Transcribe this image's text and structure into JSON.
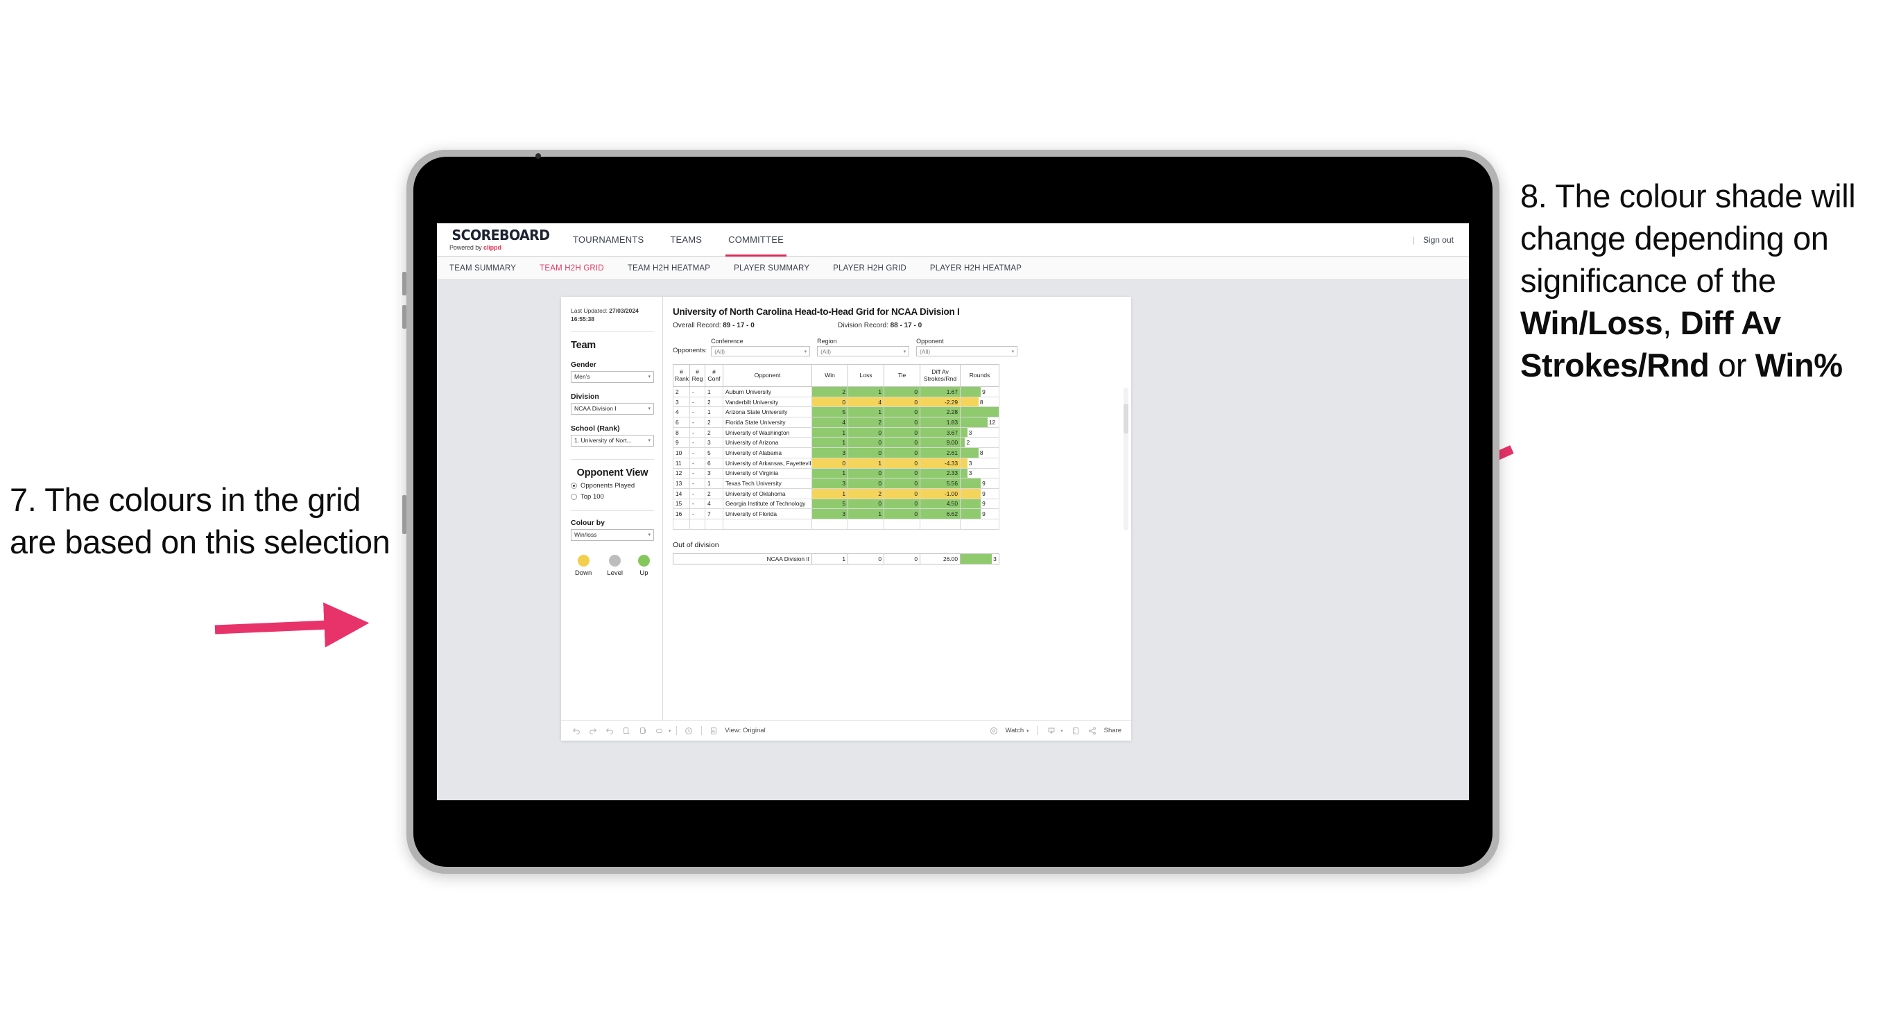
{
  "annotations": {
    "left": {
      "number": "7.",
      "text": "7. The colours in the grid are based on this selection"
    },
    "right": {
      "parts": [
        {
          "text": "8. The colour shade will change depending on significance of the ",
          "bold": false
        },
        {
          "text": "Win/Loss",
          "bold": true
        },
        {
          "text": ", ",
          "bold": false
        },
        {
          "text": "Diff Av Strokes/Rnd",
          "bold": true
        },
        {
          "text": " or ",
          "bold": false
        },
        {
          "text": "Win%",
          "bold": true
        }
      ]
    },
    "arrow_color": "#e8336a"
  },
  "header": {
    "logo_main": "SCOREBOARD",
    "logo_sub_prefix": "Powered by ",
    "logo_sub_brand": "clippd",
    "nav": [
      {
        "label": "TOURNAMENTS",
        "active": false
      },
      {
        "label": "TEAMS",
        "active": false
      },
      {
        "label": "COMMITTEE",
        "active": true
      }
    ],
    "divider": "|",
    "signout": "Sign out"
  },
  "subnav": [
    {
      "label": "TEAM SUMMARY",
      "active": false
    },
    {
      "label": "TEAM H2H GRID",
      "active": true
    },
    {
      "label": "TEAM H2H HEATMAP",
      "active": false
    },
    {
      "label": "PLAYER SUMMARY",
      "active": false
    },
    {
      "label": "PLAYER H2H GRID",
      "active": false
    },
    {
      "label": "PLAYER H2H HEATMAP",
      "active": false
    }
  ],
  "sidebar": {
    "last_updated_label": "Last Updated: ",
    "last_updated_value": "27/03/2024 16:55:38",
    "team_heading": "Team",
    "gender_label": "Gender",
    "gender_value": "Men's",
    "division_label": "Division",
    "division_value": "NCAA Division I",
    "school_label": "School (Rank)",
    "school_value": "1. University of Nort...",
    "opponent_view_heading": "Opponent View",
    "radios": [
      {
        "label": "Opponents Played",
        "selected": true
      },
      {
        "label": "Top 100",
        "selected": false
      }
    ],
    "colour_by_label": "Colour by",
    "colour_by_value": "Win/loss",
    "legend": [
      {
        "label": "Down",
        "color": "#f2cf4d"
      },
      {
        "label": "Level",
        "color": "#bdbdc0"
      },
      {
        "label": "Up",
        "color": "#86c75d"
      }
    ]
  },
  "viz": {
    "title": "University of North Carolina Head-to-Head Grid for NCAA Division I",
    "overall_record_label": "Overall Record: ",
    "overall_record_value": "89 - 17 - 0",
    "division_record_label": "Division Record: ",
    "division_record_value": "88 - 17 - 0",
    "opponents_label": "Opponents:",
    "filters": [
      {
        "label": "Conference",
        "value": "(All)"
      },
      {
        "label": "Region",
        "value": "(All)"
      },
      {
        "label": "Opponent",
        "value": "(All)"
      }
    ],
    "columns": [
      "# Rank",
      "# Reg",
      "# Conf",
      "Opponent",
      "Win",
      "Loss",
      "Tie",
      "Diff Av Strokes/Rnd",
      "Rounds"
    ],
    "rounds_max": 17,
    "rows": [
      {
        "rank": "2",
        "reg": "-",
        "conf": "1",
        "opponent": "Auburn University",
        "win": "2",
        "loss": "1",
        "tie": "0",
        "diff": "1.67",
        "rounds": "9",
        "color": "green"
      },
      {
        "rank": "3",
        "reg": "-",
        "conf": "2",
        "opponent": "Vanderbilt University",
        "win": "0",
        "loss": "4",
        "tie": "0",
        "diff": "-2.29",
        "rounds": "8",
        "color": "yellow"
      },
      {
        "rank": "4",
        "reg": "-",
        "conf": "1",
        "opponent": "Arizona State University",
        "win": "5",
        "loss": "1",
        "tie": "0",
        "diff": "2.28",
        "rounds": "17",
        "color": "green"
      },
      {
        "rank": "6",
        "reg": "-",
        "conf": "2",
        "opponent": "Florida State University",
        "win": "4",
        "loss": "2",
        "tie": "0",
        "diff": "1.83",
        "rounds": "12",
        "color": "green"
      },
      {
        "rank": "8",
        "reg": "-",
        "conf": "2",
        "opponent": "University of Washington",
        "win": "1",
        "loss": "0",
        "tie": "0",
        "diff": "3.67",
        "rounds": "3",
        "color": "green"
      },
      {
        "rank": "9",
        "reg": "-",
        "conf": "3",
        "opponent": "University of Arizona",
        "win": "1",
        "loss": "0",
        "tie": "0",
        "diff": "9.00",
        "rounds": "2",
        "color": "green"
      },
      {
        "rank": "10",
        "reg": "-",
        "conf": "5",
        "opponent": "University of Alabama",
        "win": "3",
        "loss": "0",
        "tie": "0",
        "diff": "2.61",
        "rounds": "8",
        "color": "green"
      },
      {
        "rank": "11",
        "reg": "-",
        "conf": "6",
        "opponent": "University of Arkansas, Fayetteville",
        "win": "0",
        "loss": "1",
        "tie": "0",
        "diff": "-4.33",
        "rounds": "3",
        "color": "yellow"
      },
      {
        "rank": "12",
        "reg": "-",
        "conf": "3",
        "opponent": "University of Virginia",
        "win": "1",
        "loss": "0",
        "tie": "0",
        "diff": "2.33",
        "rounds": "3",
        "color": "green"
      },
      {
        "rank": "13",
        "reg": "-",
        "conf": "1",
        "opponent": "Texas Tech University",
        "win": "3",
        "loss": "0",
        "tie": "0",
        "diff": "5.56",
        "rounds": "9",
        "color": "green"
      },
      {
        "rank": "14",
        "reg": "-",
        "conf": "2",
        "opponent": "University of Oklahoma",
        "win": "1",
        "loss": "2",
        "tie": "0",
        "diff": "-1.00",
        "rounds": "9",
        "color": "yellow"
      },
      {
        "rank": "15",
        "reg": "-",
        "conf": "4",
        "opponent": "Georgia Institute of Technology",
        "win": "5",
        "loss": "0",
        "tie": "0",
        "diff": "4.50",
        "rounds": "9",
        "color": "green"
      },
      {
        "rank": "16",
        "reg": "-",
        "conf": "7",
        "opponent": "University of Florida",
        "win": "3",
        "loss": "1",
        "tie": "0",
        "diff": "6.62",
        "rounds": "9",
        "color": "green"
      }
    ],
    "out_of_division_label": "Out of division",
    "out_of_division_row": {
      "opponent": "NCAA Division II",
      "win": "1",
      "loss": "0",
      "tie": "0",
      "diff": "26.00",
      "rounds": "3",
      "color": "green",
      "rounds_pct": 82
    },
    "colors": {
      "green": "#8fcb6e",
      "yellow": "#f5d45c"
    }
  },
  "toolbar": {
    "icons": [
      "undo-icon",
      "redo-icon",
      "revert-icon",
      "refresh-icon",
      "pause-icon",
      "custom-view-icon",
      "dropdown-caret-icon",
      "alert-icon"
    ],
    "view_label": "View: Original",
    "watch_label": "Watch",
    "share_label": "Share"
  }
}
